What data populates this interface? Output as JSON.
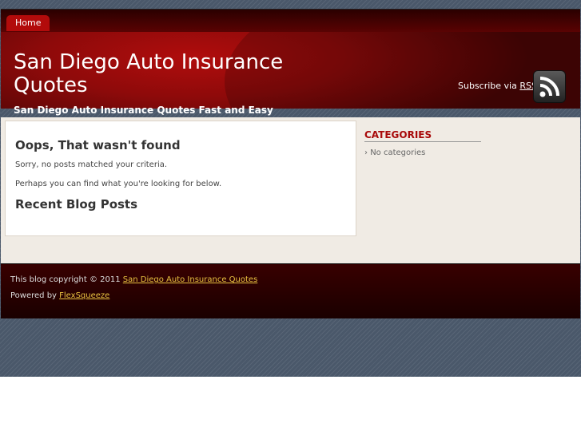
{
  "nav": {
    "home_label": "Home"
  },
  "header": {
    "title_line1": "San Diego Auto Insurance",
    "title_line2": "Quotes",
    "subscribe_prefix": "Subscribe via",
    "subscribe_link": "RSS",
    "tagline": "San Diego Auto Insurance Quotes Fast and Easy"
  },
  "main": {
    "heading": "Oops, That wasn't found",
    "message1": "Sorry, no posts matched your criteria.",
    "message2": "Perhaps you can find what you're looking for below.",
    "recent_heading": "Recent Blog Posts"
  },
  "sidebar": {
    "title": "CATEGORIES",
    "item_prefix": "›",
    "item": "No categories"
  },
  "footer": {
    "copyright_prefix": "This blog copyright © 2011",
    "copyright_link": "San Diego Auto Insurance Quotes",
    "powered_prefix": "Powered by",
    "powered_link": "FlexSqueeze"
  },
  "colors": {
    "header_red": "#b00d0d",
    "accent_red": "#a80a0a",
    "footer_link": "#e8c040",
    "stripe_bg": "#4a586a"
  }
}
